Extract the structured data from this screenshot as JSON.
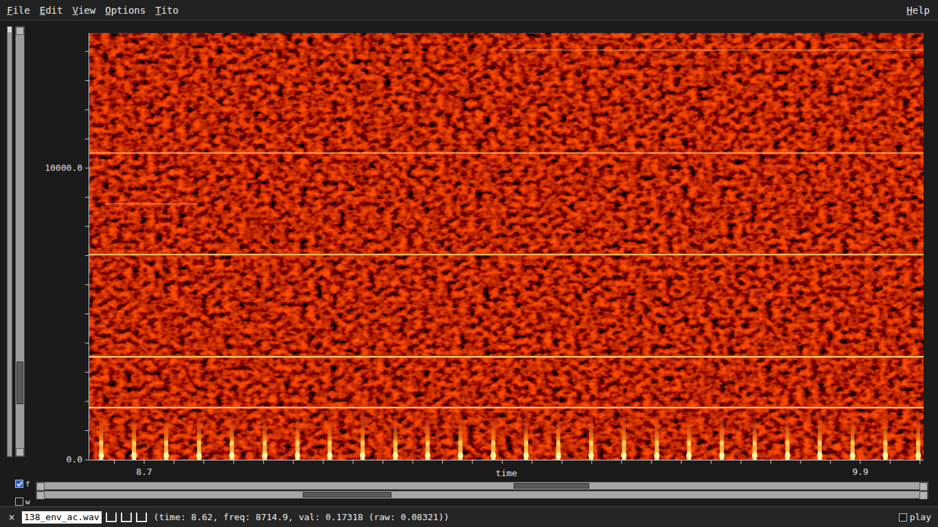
{
  "menu": [
    {
      "label": "File"
    },
    {
      "label": "Edit"
    },
    {
      "label": "View"
    },
    {
      "label": "Options"
    },
    {
      "label": "Tito"
    }
  ],
  "help_menu": {
    "label": "Help"
  },
  "spectrogram": {
    "y_axis": {
      "ticks": [
        {
          "label": "0.0",
          "value": 0
        },
        {
          "label": "10000.0",
          "value": 10000
        }
      ]
    },
    "x_axis": {
      "title": "time",
      "ticks": [
        {
          "label": "8.7",
          "value": 8.7
        },
        {
          "label": "9.9",
          "value": 9.9
        }
      ]
    },
    "harmonics": [
      {
        "freq": 1790,
        "intensity": 1.0,
        "start": 8.608,
        "end": 10.006
      },
      {
        "freq": 3530,
        "intensity": 0.95,
        "start": 8.608,
        "end": 10.006
      },
      {
        "freq": 7035,
        "intensity": 0.8,
        "start": 8.608,
        "end": 10.006
      },
      {
        "freq": 8775,
        "intensity": 0.35,
        "start": 8.635,
        "end": 8.79
      },
      {
        "freq": 10520,
        "intensity": 0.6,
        "start": 8.608,
        "end": 10.006
      },
      {
        "freq": 14045,
        "intensity": 0.35,
        "start": 9.3,
        "end": 10.006
      }
    ],
    "pulses": {
      "top_freq": 1650,
      "times": [
        8.628,
        8.683,
        8.737,
        8.792,
        8.847,
        8.902,
        8.957,
        9.011,
        9.066,
        9.121,
        9.175,
        9.23,
        9.285,
        9.34,
        9.394,
        9.449,
        9.504,
        9.559,
        9.613,
        9.668,
        9.723,
        9.778,
        9.832,
        9.887,
        9.942,
        9.997
      ]
    }
  },
  "panel_toggles": [
    {
      "label": "f",
      "checked": true
    },
    {
      "label": "w",
      "checked": false
    }
  ],
  "vertical_scroll": {
    "start": 0.79,
    "span": 0.1
  },
  "horizontal_scrolls": [
    {
      "start": 0.536,
      "span": 0.085
    },
    {
      "start": 0.295,
      "span": 0.1
    }
  ],
  "status_bar": {
    "close": "×",
    "file": "138_env_ac.wav",
    "readout": "(time: 8.62, freq: 8714.9, val: 0.17318 (raw: 0.08321))",
    "play": {
      "label": "play",
      "checked": false
    }
  }
}
